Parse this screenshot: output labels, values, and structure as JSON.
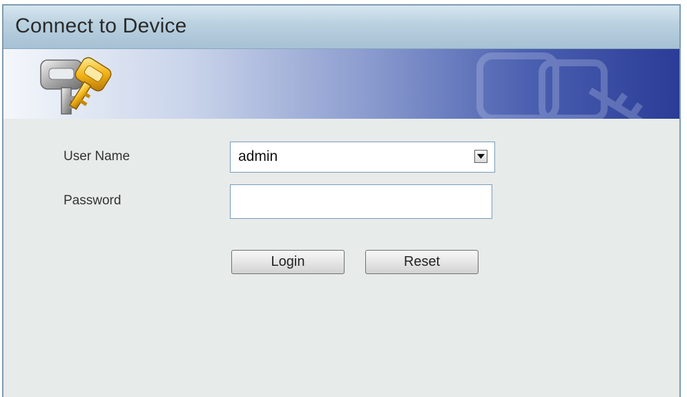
{
  "dialog": {
    "title": "Connect to Device"
  },
  "form": {
    "user_name_label": "User Name",
    "user_name_value": "admin",
    "password_label": "Password",
    "password_value": ""
  },
  "buttons": {
    "login_label": "Login",
    "reset_label": "Reset"
  },
  "icons": {
    "banner_icon": "keys-icon",
    "dropdown_icon": "chevron-down-icon"
  },
  "colors": {
    "banner_dark": "#2a3c97",
    "titlebar": "#b9d0df",
    "background": "#e7ebea"
  }
}
